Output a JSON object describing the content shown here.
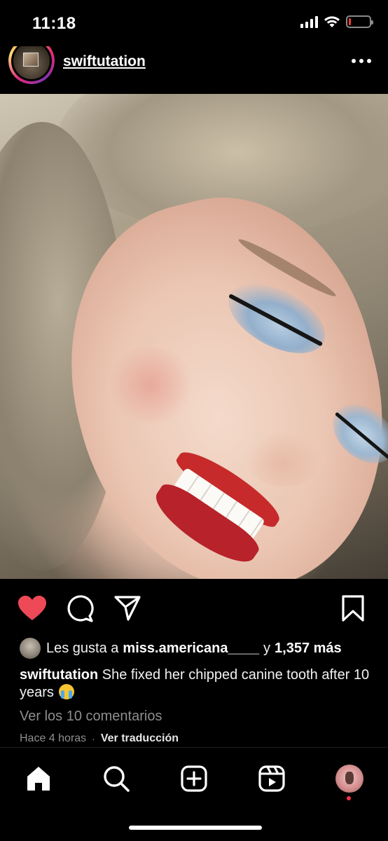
{
  "status_bar": {
    "time": "11:18",
    "battery_level": 0.12,
    "battery_color": "#ff3b30"
  },
  "post": {
    "username": "swiftutation",
    "image_alt": "",
    "liked": true,
    "like_color": "#ed4956"
  },
  "likes": {
    "prefix": "Les gusta a",
    "user": "miss.americana____",
    "connector": "y",
    "count": "1,357 más"
  },
  "caption": {
    "username": "swiftutation",
    "text": "She fixed her chipped canine tooth after 10 years"
  },
  "comments_link": "Ver los 10 comentarios",
  "time_ago": "Hace 4 horas",
  "separator": "·",
  "translate": "Ver traducción",
  "icons": {
    "like": "heart-icon",
    "comment": "comment-icon",
    "share": "send-icon",
    "save": "bookmark-icon",
    "home": "home-icon",
    "search": "search-icon",
    "create": "add-post-icon",
    "reels": "reels-icon",
    "profile": "profile-avatar"
  }
}
